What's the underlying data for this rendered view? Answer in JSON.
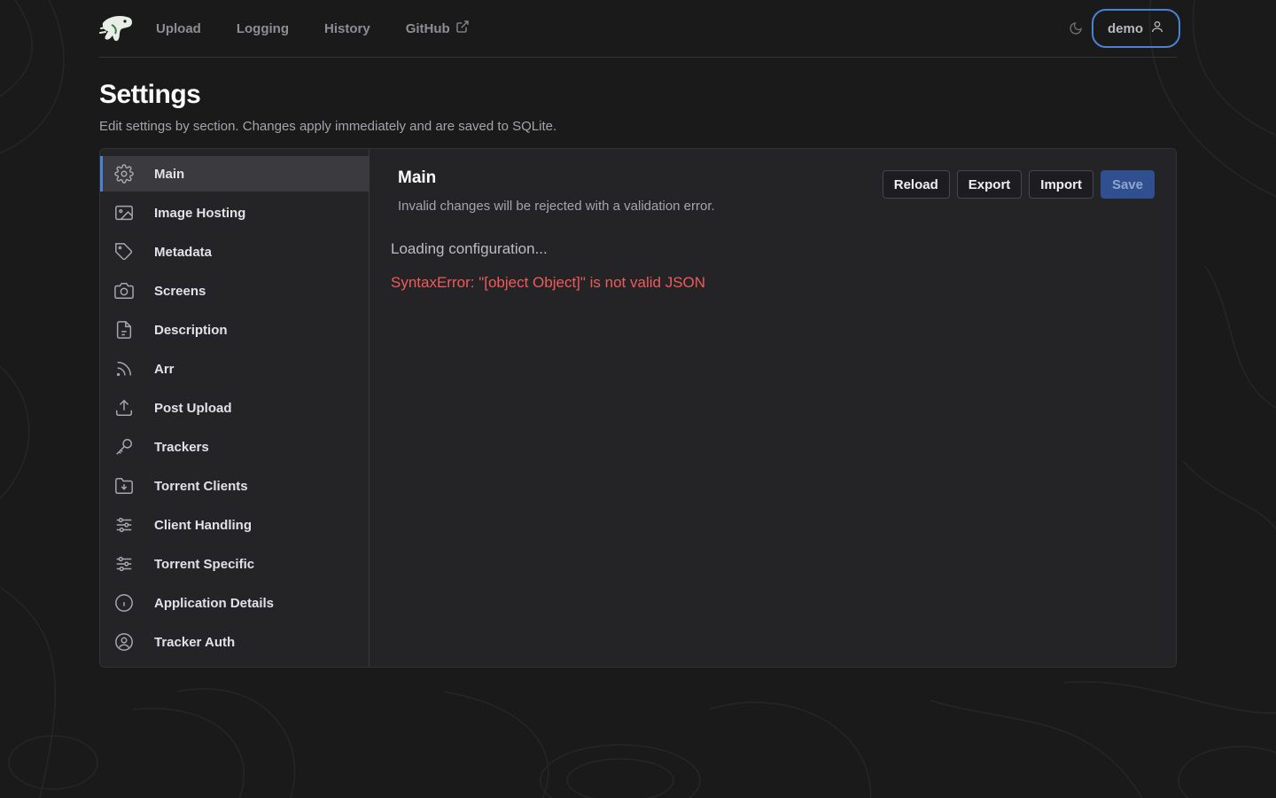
{
  "nav": {
    "links": [
      {
        "label": "Upload"
      },
      {
        "label": "Logging"
      },
      {
        "label": "History"
      },
      {
        "label": "GitHub",
        "icon": "external-link-icon"
      }
    ],
    "theme_icon": "moon-icon",
    "user": {
      "label": "demo",
      "icon": "user-icon"
    }
  },
  "header": {
    "title": "Settings",
    "subtitle": "Edit settings by section. Changes apply immediately and are saved to SQLite."
  },
  "sidebar": {
    "active_index": 0,
    "items": [
      {
        "label": "Main",
        "icon": "gear-icon"
      },
      {
        "label": "Image Hosting",
        "icon": "image-icon"
      },
      {
        "label": "Metadata",
        "icon": "tag-icon"
      },
      {
        "label": "Screens",
        "icon": "camera-icon"
      },
      {
        "label": "Description",
        "icon": "document-icon"
      },
      {
        "label": "Arr",
        "icon": "rss-icon"
      },
      {
        "label": "Post Upload",
        "icon": "upload-icon"
      },
      {
        "label": "Trackers",
        "icon": "key-icon"
      },
      {
        "label": "Torrent Clients",
        "icon": "folder-download-icon"
      },
      {
        "label": "Client Handling",
        "icon": "sliders-icon"
      },
      {
        "label": "Torrent Specific",
        "icon": "sliders-icon"
      },
      {
        "label": "Application Details",
        "icon": "info-icon"
      },
      {
        "label": "Tracker Auth",
        "icon": "user-circle-icon"
      }
    ]
  },
  "main": {
    "title": "Main",
    "subtitle": "Invalid changes will be rejected with a validation error.",
    "buttons": {
      "reload": "Reload",
      "export": "Export",
      "import": "Import",
      "save": "Save"
    },
    "loading": "Loading configuration...",
    "error": "SyntaxError: \"[object Object]\" is not valid JSON"
  },
  "colors": {
    "accent": "#4a82d6",
    "error": "#f05a5a",
    "background": "#1a1a1b",
    "panel": "#242427"
  }
}
